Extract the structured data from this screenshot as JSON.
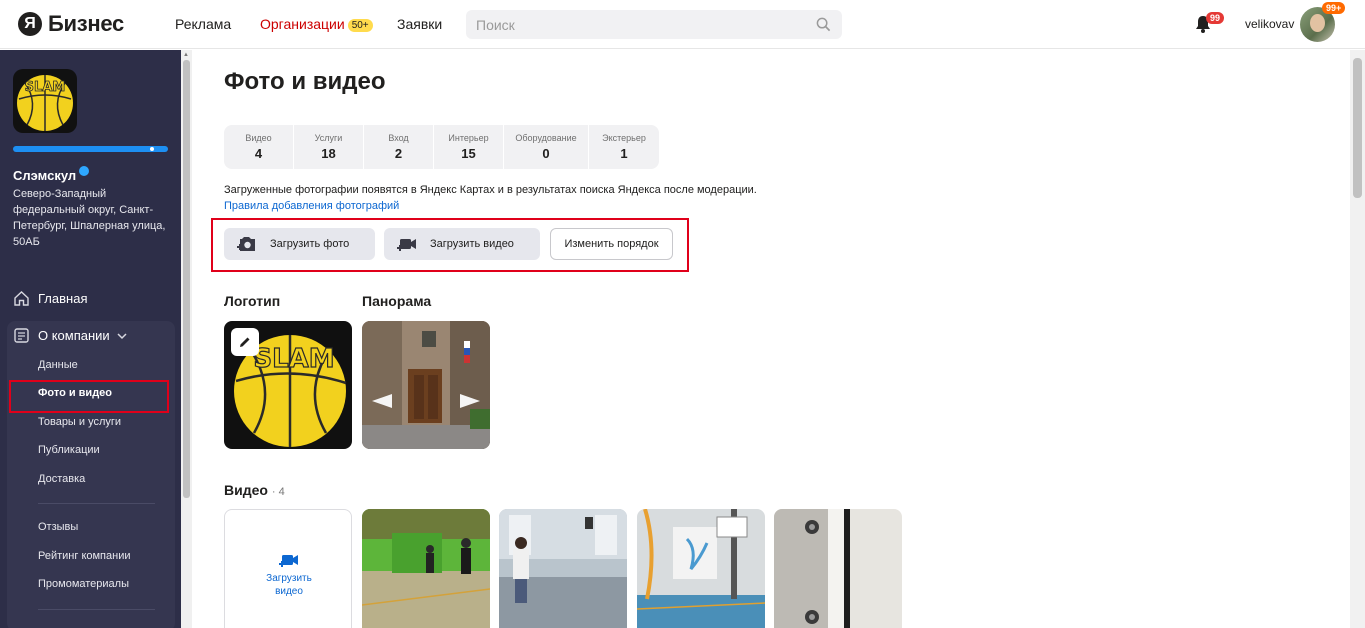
{
  "header": {
    "logo_letter": "Я",
    "logo_text": "Бизнес",
    "nav": [
      {
        "label": "Реклама"
      },
      {
        "label": "Организации",
        "badge": "50+"
      },
      {
        "label": "Заявки"
      }
    ],
    "search_placeholder": "Поиск",
    "notifications_count": "99",
    "user_name": "velikovav",
    "avatar_badge": "99+"
  },
  "sidebar": {
    "company_name": "Слэмскул",
    "address": "Северо-Западный федеральный округ, Санкт-Петербург, Шпалерная улица, 50АБ",
    "menu": {
      "home": "Главная",
      "about": "О компании"
    },
    "submenu": [
      "Данные",
      "Фото и видео",
      "Товары и услуги",
      "Публикации",
      "Доставка"
    ],
    "submenu2": [
      "Отзывы",
      "Рейтинг компании",
      "Промоматериалы"
    ],
    "logo_text": "SLAM"
  },
  "main": {
    "title": "Фото и видео",
    "stats": [
      {
        "label": "Видео",
        "value": "4"
      },
      {
        "label": "Услуги",
        "value": "18"
      },
      {
        "label": "Вход",
        "value": "2"
      },
      {
        "label": "Интерьер",
        "value": "15"
      },
      {
        "label": "Оборудование",
        "value": "0"
      },
      {
        "label": "Экстерьер",
        "value": "1"
      }
    ],
    "notice": "Загруженные фотографии появятся в Яндекс Картах и в результатах поиска Яндекса после модерации.",
    "rules_link": "Правила добавления фотографий",
    "buttons": {
      "upload_photo": "Загрузить фото",
      "upload_video": "Загрузить видео",
      "change_order": "Изменить порядок"
    },
    "sections": {
      "logo": "Логотип",
      "panorama": "Панорама",
      "video": "Видео",
      "video_count": "· 4"
    },
    "upload_video_tile": "Загрузить видео",
    "logo_image_text": "SLAM"
  },
  "colors": {
    "sidebar_bg": "#2d2e48",
    "accent_blue": "#0c67d1",
    "highlight_red": "#e0001a",
    "badge_yellow": "#ffdb4d"
  }
}
